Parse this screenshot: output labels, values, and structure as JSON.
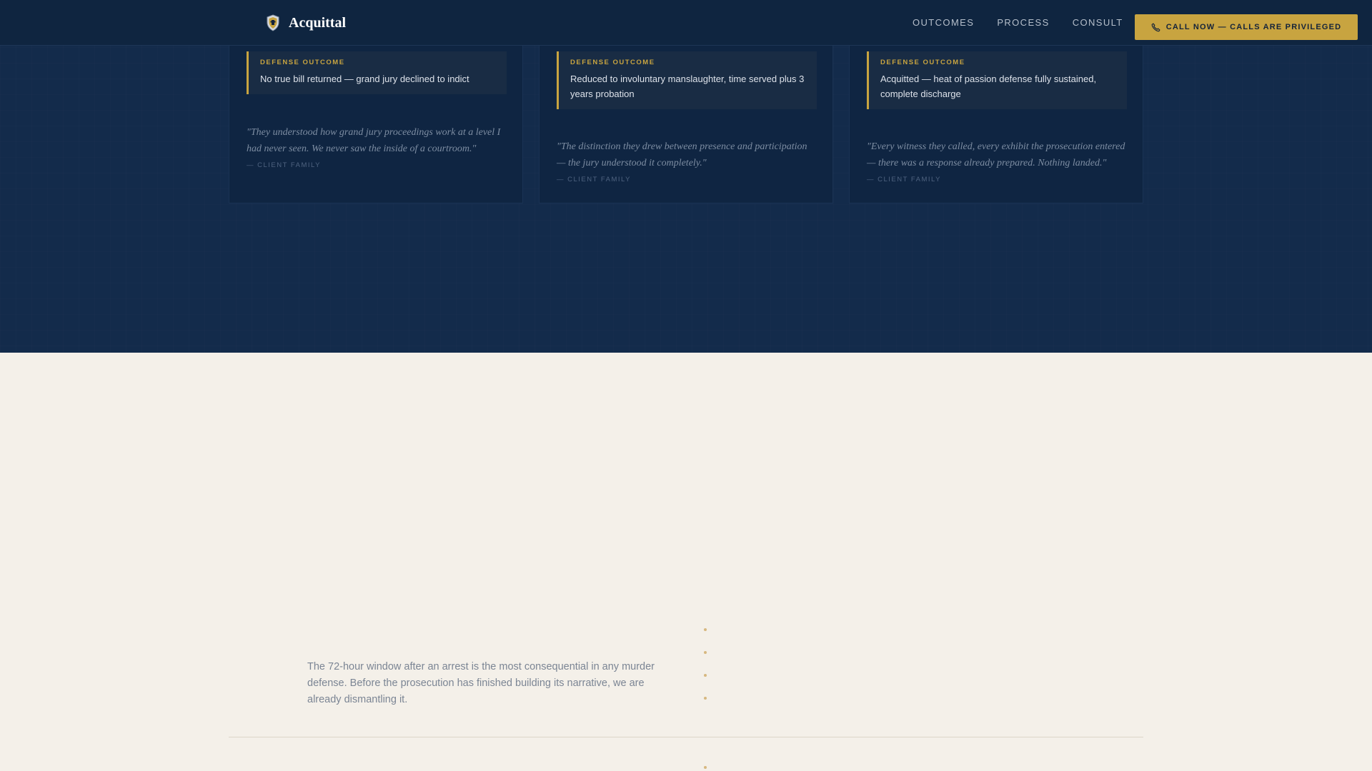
{
  "nav": {
    "brand": "Acquittal",
    "brand_icon": "shield-crest-icon",
    "links": [
      "OUTCOMES",
      "PROCESS",
      "CONSULT"
    ],
    "cta_label": "CALL NOW — CALLS ARE PRIVILEGED",
    "cta_icon": "phone-icon"
  },
  "cards": [
    {
      "outcome_label": "DEFENSE OUTCOME",
      "outcome": "No true bill returned — grand jury declined to indict",
      "quote": "\"They understood how grand jury proceedings work at a level I had never seen. We never saw the inside of a courtroom.\"",
      "attribution": "— CLIENT FAMILY"
    },
    {
      "outcome_label": "DEFENSE OUTCOME",
      "outcome": "Reduced to involuntary manslaughter, time served plus 3 years probation",
      "quote": "\"The distinction they drew between presence and participation — the jury understood it completely.\"",
      "attribution": "— CLIENT FAMILY"
    },
    {
      "outcome_label": "DEFENSE OUTCOME",
      "outcome": "Acquitted — heat of passion defense fully sustained, complete discharge",
      "quote": "\"Every witness they called, every exhibit the prosecution entered — there was a response already prepared. Nothing landed.\"",
      "attribution": "— CLIENT FAMILY"
    }
  ],
  "process": {
    "intro": "The 72-hour window after an arrest is the most consequential in any murder defense. Before the prosecution has finished building its narrative, we are already dismantling it."
  },
  "colors": {
    "navy": "#132b4b",
    "navy_dark": "#0f2540",
    "gold": "#c8a440",
    "cream": "#f4f0e9"
  }
}
